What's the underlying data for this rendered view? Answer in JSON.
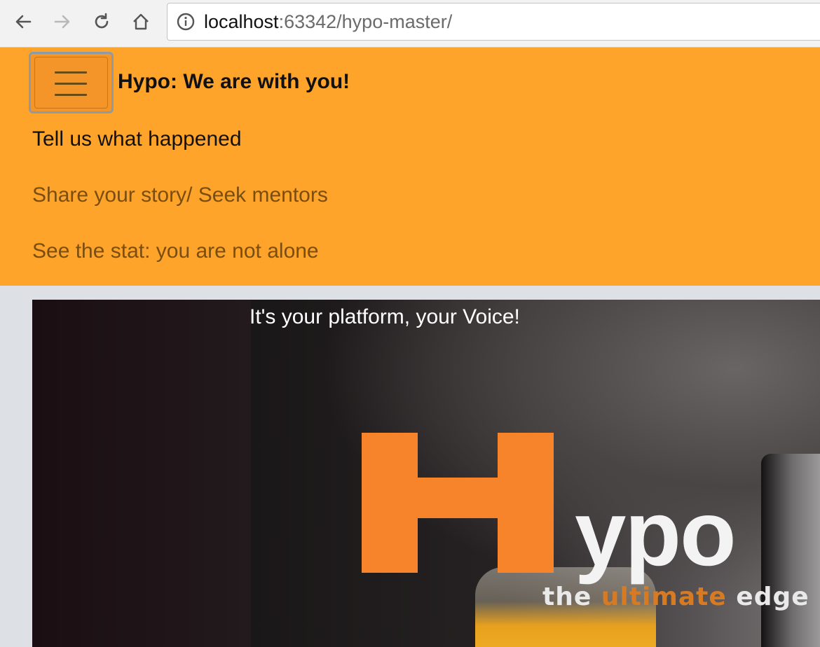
{
  "browser": {
    "url_host": "localhost",
    "url_rest": ":63342/hypo-master/",
    "buttons": {
      "back": "arrow-left-icon",
      "forward": "arrow-right-icon",
      "reload": "reload-icon",
      "home": "home-icon",
      "site_info": "info-icon"
    }
  },
  "navbar": {
    "brand": "Hypo: We are with you!",
    "toggler_icon": "hamburger-menu-icon",
    "links": [
      {
        "label": "Tell us what happened"
      },
      {
        "label": "Share your story/ Seek mentors"
      },
      {
        "label": "See the stat: you are not alone"
      }
    ],
    "background_color": "#fea42b"
  },
  "hero": {
    "title": "It's your platform, your Voice!",
    "logo": {
      "initial": "H",
      "rest": "ypo",
      "tagline_pre": "the ",
      "tagline_highlight": "ultimate",
      "tagline_post": " edge"
    },
    "accent_color": "#f7832a"
  }
}
